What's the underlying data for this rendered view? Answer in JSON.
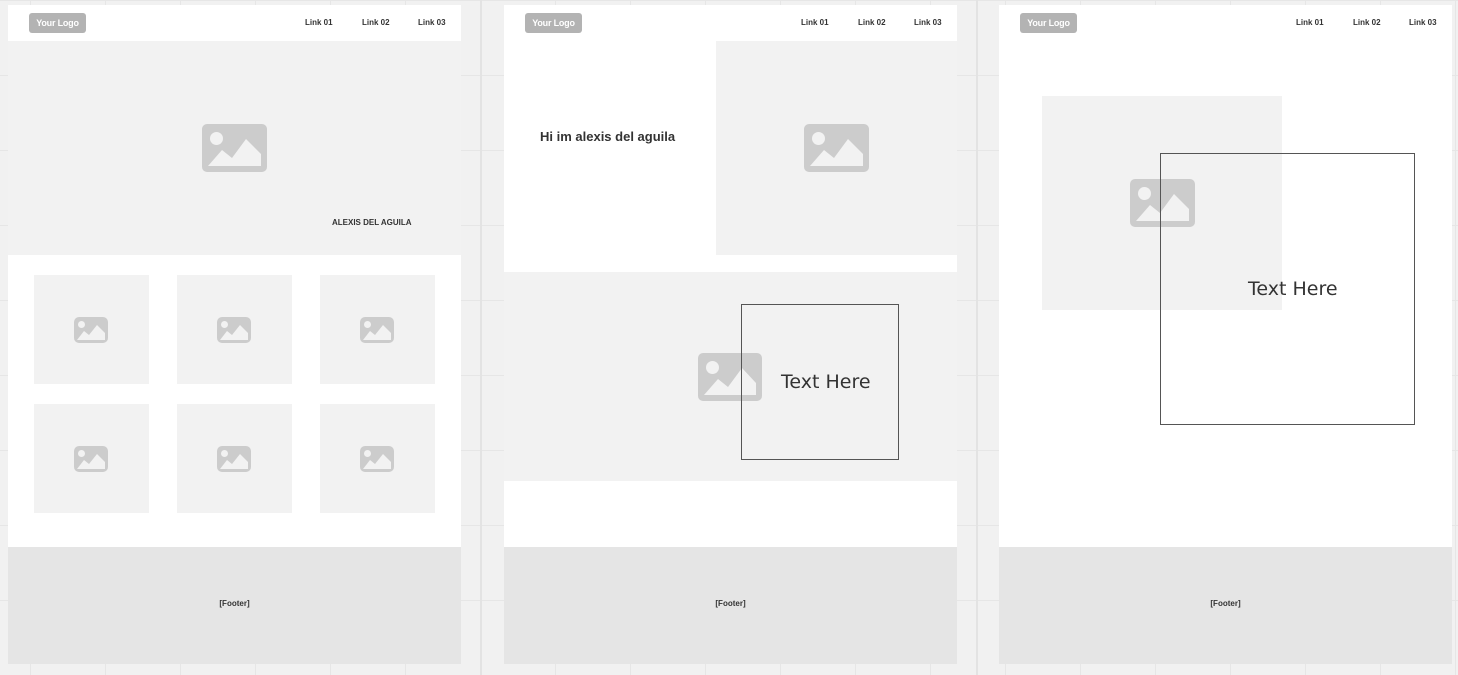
{
  "header": {
    "logo": "Your Logo",
    "links": [
      "Link 01",
      "Link 02",
      "Link 03"
    ]
  },
  "frame1": {
    "hero_caption": "ALEXIS DEL AGUILA",
    "gallery_count": 6,
    "footer": "[Footer]"
  },
  "frame2": {
    "intro": "Hi im alexis del aguila",
    "box_text": "Text Here",
    "footer": "[Footer]"
  },
  "frame3": {
    "box_text": "Text Here",
    "footer": "[Footer]"
  },
  "icons": {
    "image_placeholder": "image-placeholder-icon"
  },
  "colors": {
    "placeholder_bg": "#f2f2f2",
    "icon_gray": "#cccccc",
    "logo_gray": "#b3b3b3",
    "footer_bg": "#e5e5e5",
    "canvas_bg": "#f1f1f1"
  }
}
